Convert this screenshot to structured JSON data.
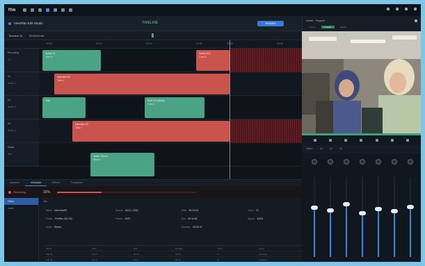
{
  "app": {
    "logo": "ffm",
    "project_name": "ViewPlan Edit Studio",
    "timeline_title": "TIMELINE",
    "render_label": "RENDER"
  },
  "timeline": {
    "sub_left": "Timeline 01",
    "sub_right": "00:00:00:00",
    "ruler_ticks": [
      "00:00",
      "00:10",
      "00:20",
      "00:30",
      "00:40",
      "00:50"
    ],
    "tracks": [
      {
        "label": "Recording",
        "sub": "V1"
      },
      {
        "label": "A1",
        "sub": "Audio 1"
      },
      {
        "label": "A2",
        "sub": "Audio 2"
      },
      {
        "label": "A3",
        "sub": "Audio 3"
      },
      {
        "label": "Music",
        "sub": "Bed"
      }
    ],
    "clips": [
      {
        "color": "green",
        "title": "Scene 01",
        "sub": "Cam A"
      },
      {
        "color": "red",
        "title": "Scene 01b",
        "sub": "Cam B"
      },
      {
        "color": "red",
        "title": "Interview 02",
        "sub": "Take 3"
      },
      {
        "color": "green",
        "title": "Take",
        "sub": ""
      },
      {
        "color": "green",
        "title": "Broll 04 Hallway",
        "sub": "Cam A"
      },
      {
        "color": "red",
        "title": "Interview 03",
        "sub": "Take 1"
      },
      {
        "color": "green",
        "title": "Music Theme",
        "sub": "Stereo"
      }
    ]
  },
  "bottom_tabs": [
    "Inspector",
    "Metadata",
    "Effects",
    "Transitions"
  ],
  "render": {
    "label": "Rendering",
    "percent_text": "32%",
    "progress": 0.32
  },
  "props": {
    "side_items": [
      "Video",
      "Audio"
    ],
    "section": "Clip",
    "fields": [
      {
        "k": "Name",
        "v": "Interview03"
      },
      {
        "k": "Source",
        "v": "A012_C004"
      },
      {
        "k": "Start",
        "v": "00:12:04"
      },
      {
        "k": "Track",
        "v": "V1"
      },
      {
        "k": "Codec",
        "v": "ProRes 422 HQ"
      },
      {
        "k": "Frame",
        "v": "1920"
      },
      {
        "k": "End",
        "v": "00:14:51"
      },
      {
        "k": "Speed",
        "v": "100%"
      },
      {
        "k": "Audio",
        "v": "Stereo"
      },
      {
        "k": "Duration",
        "v": "00:02:47"
      }
    ],
    "grid_headers": [
      "Name",
      "Start",
      "End",
      "Duration",
      "Track",
      "Notes"
    ],
    "grid_rows": [
      [
        "Clip 01",
        "00:00",
        "00:10",
        "00:10",
        "V1",
        "Opening"
      ],
      [
        "Clip 02",
        "00:10",
        "00:24",
        "00:14",
        "V1",
        "Interview"
      ]
    ]
  },
  "viewer": {
    "title": "Viewer - Program",
    "tabs": [
      "Source",
      "Program",
      "Effects"
    ]
  },
  "mixer": {
    "tabs": [
      "Master",
      "A1",
      "A2",
      "A3"
    ],
    "channels": [
      {
        "level": 0.62
      },
      {
        "level": 0.58
      },
      {
        "level": 0.66
      },
      {
        "level": 0.55
      },
      {
        "level": 0.6
      },
      {
        "level": 0.57
      },
      {
        "level": 0.63
      }
    ]
  },
  "colors": {
    "accent": "#3d8de0",
    "clip_green": "#4aa384",
    "clip_red": "#c8544d",
    "bg": "#141a22"
  }
}
